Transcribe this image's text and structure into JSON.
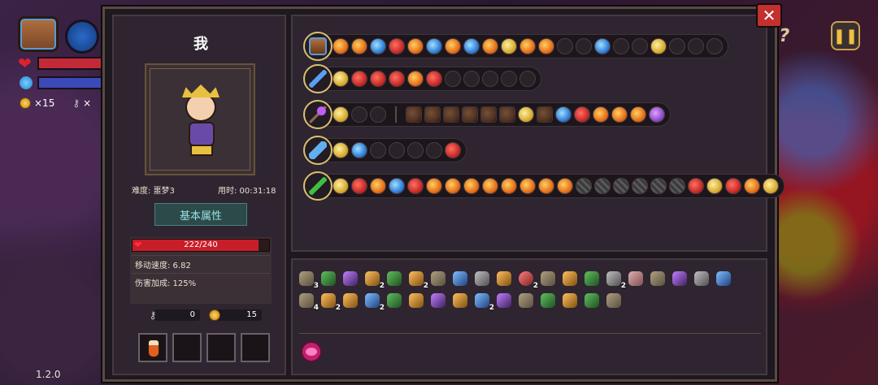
{
  "hud": {
    "coins": "×15",
    "keys": "×",
    "version": "1.2.0"
  },
  "stats": {
    "player_name": "我",
    "difficulty": "难度: 噩梦3",
    "playtime": "用时: 00:31:18",
    "basic_attr_tab": "基本属性",
    "hp_text": "222/240",
    "hp_current": 222,
    "hp_max": 240,
    "move_speed": "移动速度: 6.82",
    "damage_bonus": "伤害加成: 125%",
    "keys": "0",
    "coins": "15"
  },
  "buttons": {
    "close": "✕",
    "pause": "❚❚",
    "help": "?"
  },
  "weapons": [
    {
      "icon": "chest",
      "cells": [
        "orange",
        "orange",
        "blue",
        "red",
        "orange",
        "blue",
        "orange",
        "blue",
        "orange",
        "gold",
        "orange",
        "orange",
        "empty",
        "empty",
        "blue",
        "empty",
        "empty",
        "gold",
        "empty",
        "empty",
        "empty"
      ]
    },
    {
      "icon": "sword",
      "cells": [
        "gold",
        "red",
        "red",
        "red",
        "orange",
        "red",
        "empty",
        "empty",
        "empty",
        "empty",
        "empty"
      ]
    },
    {
      "icon": "staff",
      "cells": [
        "gold",
        "empty",
        "empty",
        "|",
        "dim",
        "dim",
        "dim",
        "dim",
        "dim",
        "dim",
        "gold",
        "dim",
        "blue",
        "red",
        "orange",
        "orange",
        "orange",
        "purple"
      ]
    },
    {
      "icon": "blade",
      "cells": [
        "gold",
        "blue",
        "empty",
        "empty",
        "empty",
        "empty",
        "red"
      ]
    },
    {
      "icon": "leaf",
      "cells": [
        "gold",
        "red",
        "orange",
        "blue",
        "red",
        "orange",
        "orange",
        "orange",
        "orange",
        "orange",
        "orange",
        "orange",
        "orange",
        "stripe",
        "stripe",
        "stripe",
        "stripe",
        "stripe",
        "stripe",
        "red",
        "gold",
        "red",
        "orange",
        "gold"
      ]
    }
  ],
  "inventory": [
    {
      "c": "c1",
      "n": "3"
    },
    {
      "c": "c2",
      "n": ""
    },
    {
      "c": "c3",
      "n": ""
    },
    {
      "c": "c4",
      "n": "2"
    },
    {
      "c": "c2",
      "n": ""
    },
    {
      "c": "c4",
      "n": "2"
    },
    {
      "c": "c1",
      "n": ""
    },
    {
      "c": "c5",
      "n": ""
    },
    {
      "c": "c7",
      "n": ""
    },
    {
      "c": "c4",
      "n": ""
    },
    {
      "c": "c6",
      "n": "2"
    },
    {
      "c": "c1",
      "n": ""
    },
    {
      "c": "c4",
      "n": ""
    },
    {
      "c": "c2",
      "n": ""
    },
    {
      "c": "c7",
      "n": "2"
    },
    {
      "c": "c8",
      "n": ""
    },
    {
      "c": "c1",
      "n": ""
    },
    {
      "c": "c3",
      "n": ""
    },
    {
      "c": "c7",
      "n": ""
    },
    {
      "c": "c5",
      "n": ""
    },
    {
      "c": "c1",
      "n": "4"
    },
    {
      "c": "c4",
      "n": "2"
    },
    {
      "c": "c4",
      "n": ""
    },
    {
      "c": "c5",
      "n": "2"
    },
    {
      "c": "c2",
      "n": ""
    },
    {
      "c": "c4",
      "n": ""
    },
    {
      "c": "c3",
      "n": ""
    },
    {
      "c": "c4",
      "n": ""
    },
    {
      "c": "c5",
      "n": "2"
    },
    {
      "c": "c3",
      "n": ""
    },
    {
      "c": "c1",
      "n": ""
    },
    {
      "c": "c2",
      "n": ""
    },
    {
      "c": "c4",
      "n": ""
    },
    {
      "c": "c2",
      "n": ""
    },
    {
      "c": "c1",
      "n": ""
    }
  ]
}
